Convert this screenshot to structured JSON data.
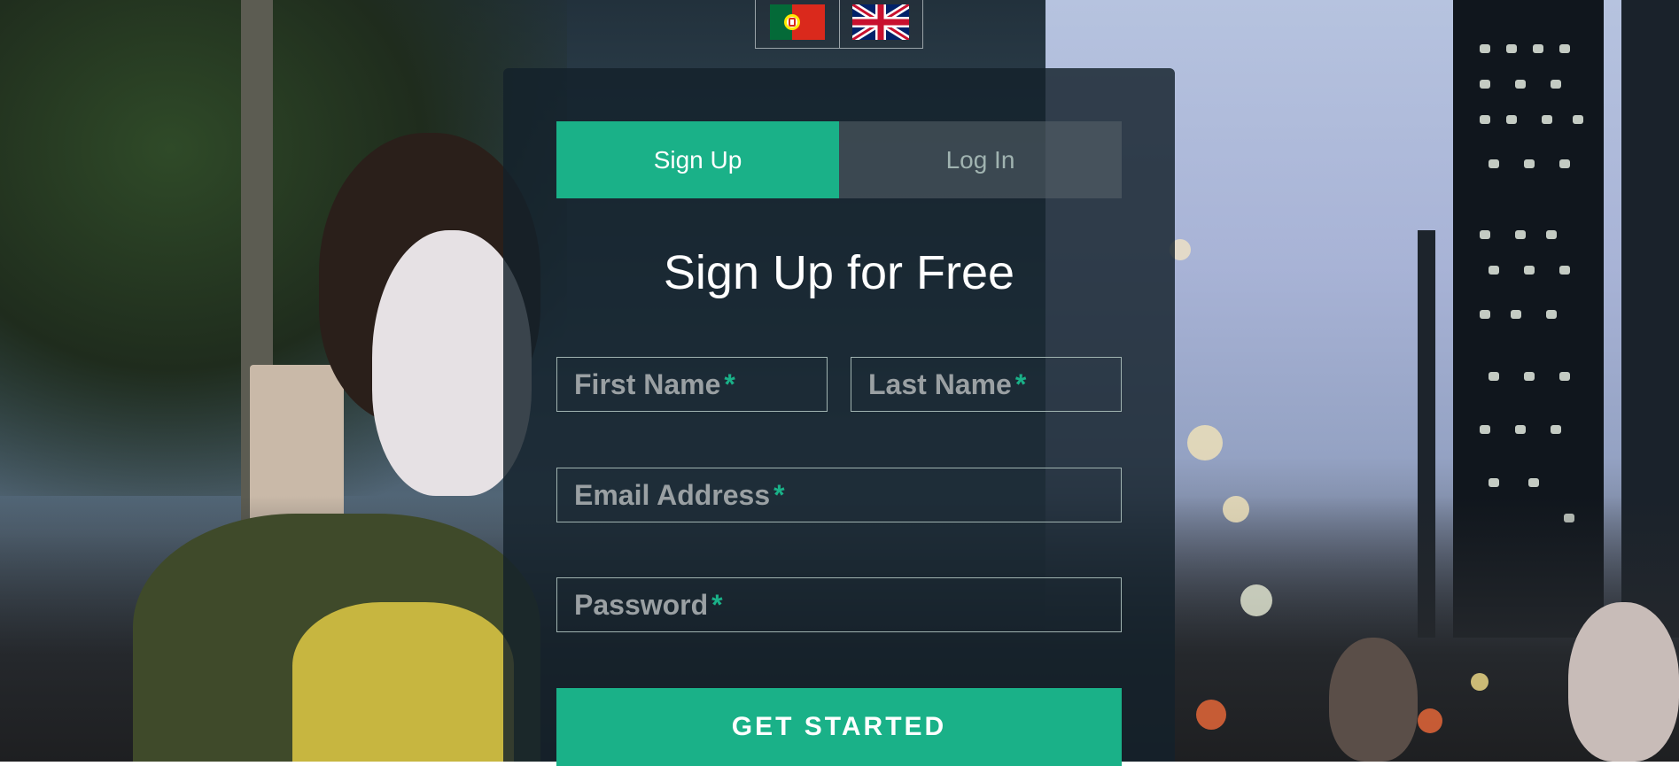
{
  "languages": [
    {
      "name": "Portuguese",
      "icon": "flag-portugal-icon"
    },
    {
      "name": "English",
      "icon": "flag-uk-icon"
    }
  ],
  "tabs": {
    "signup": "Sign Up",
    "login": "Log In"
  },
  "form": {
    "title": "Sign Up for Free",
    "first_name": "First Name",
    "last_name": "Last Name",
    "email": "Email Address",
    "password": "Password",
    "required_marker": "*",
    "submit": "GET STARTED"
  },
  "colors": {
    "accent": "#1ab188",
    "panel": "#14212b",
    "inactive_tab": "#5a656c",
    "field_border": "#a0b3b0"
  }
}
